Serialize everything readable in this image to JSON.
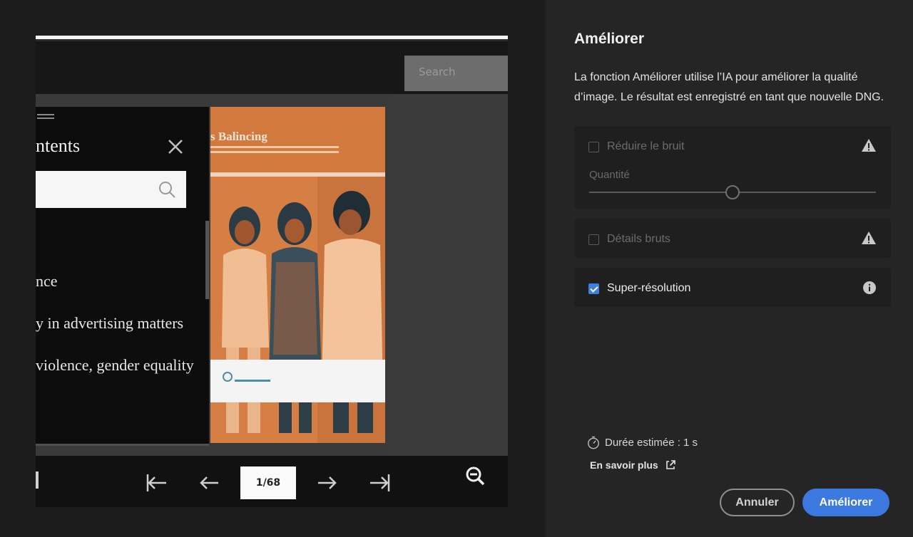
{
  "preview": {
    "search_placeholder": "Search",
    "toc_title": "ntents",
    "toc_items": [
      "nce",
      "y in advertising matters",
      "violence, gender equality"
    ],
    "cover_title": "s Balincing",
    "page_indicator": "1/68"
  },
  "dialog": {
    "title": "Améliorer",
    "description": "La fonction Améliorer utilise l’IA pour améliorer la qualité d’image. Le résultat est enregistré en tant que nouvelle DNG.",
    "options": {
      "denoise": {
        "label": "Réduire le bruit",
        "checked": false,
        "enabled": false,
        "icon": "warning-icon"
      },
      "amount_label": "Quantité",
      "amount_value": 0.5,
      "raw_details": {
        "label": "Détails bruts",
        "checked": false,
        "enabled": false,
        "icon": "warning-icon"
      },
      "super_resolution": {
        "label": "Super-résolution",
        "checked": true,
        "enabled": true,
        "icon": "info-icon"
      }
    },
    "estimated_time": "Durée estimée : 1 s",
    "learn_more": "En savoir plus",
    "cancel_label": "Annuler",
    "confirm_label": "Améliorer",
    "accent_color": "#3b78e0"
  }
}
